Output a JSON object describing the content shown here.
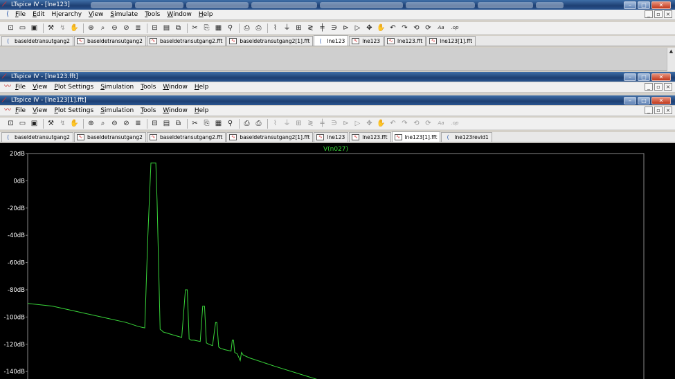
{
  "window1": {
    "title": "LTspice IV - [lne123]",
    "menu": [
      {
        "pre": "",
        "ul": "F",
        "post": "ile"
      },
      {
        "pre": "",
        "ul": "E",
        "post": "dit"
      },
      {
        "pre": "H",
        "ul": "i",
        "post": "erarchy"
      },
      {
        "pre": "",
        "ul": "V",
        "post": "iew"
      },
      {
        "pre": "",
        "ul": "S",
        "post": "imulate"
      },
      {
        "pre": "",
        "ul": "T",
        "post": "ools"
      },
      {
        "pre": "",
        "ul": "W",
        "post": "indow"
      },
      {
        "pre": "",
        "ul": "H",
        "post": "elp"
      }
    ],
    "tabs": [
      {
        "label": "baseldetransutgang2",
        "icon": "schematic-icon",
        "active": false
      },
      {
        "label": "baseldetransutgang2",
        "icon": "waveform-icon",
        "active": false
      },
      {
        "label": "baseldetransutgang2.fft",
        "icon": "waveform-icon",
        "active": false
      },
      {
        "label": "baseldetransutgang2[1].fft",
        "icon": "waveform-icon",
        "active": false
      },
      {
        "label": "lne123",
        "icon": "schematic-icon",
        "active": true
      },
      {
        "label": "lne123",
        "icon": "waveform-icon",
        "active": false
      },
      {
        "label": "lne123.fft",
        "icon": "waveform-icon",
        "active": false
      },
      {
        "label": "lne123[1].fft",
        "icon": "waveform-icon",
        "active": false
      }
    ]
  },
  "window2": {
    "title": "LTspice IV - [lne123.fft]",
    "menu": [
      {
        "pre": "",
        "ul": "F",
        "post": "ile"
      },
      {
        "pre": "",
        "ul": "V",
        "post": "iew"
      },
      {
        "pre": "",
        "ul": "P",
        "post": "lot Settings"
      },
      {
        "pre": "",
        "ul": "S",
        "post": "imulation"
      },
      {
        "pre": "",
        "ul": "T",
        "post": "ools"
      },
      {
        "pre": "",
        "ul": "W",
        "post": "indow"
      },
      {
        "pre": "",
        "ul": "H",
        "post": "elp"
      }
    ]
  },
  "window3": {
    "title": "LTspice IV - [lne123[1].fft]",
    "menu": [
      {
        "pre": "",
        "ul": "F",
        "post": "ile"
      },
      {
        "pre": "",
        "ul": "V",
        "post": "iew"
      },
      {
        "pre": "",
        "ul": "P",
        "post": "lot Settings"
      },
      {
        "pre": "",
        "ul": "S",
        "post": "imulation"
      },
      {
        "pre": "",
        "ul": "T",
        "post": "ools"
      },
      {
        "pre": "",
        "ul": "W",
        "post": "indow"
      },
      {
        "pre": "",
        "ul": "H",
        "post": "elp"
      }
    ],
    "tabs": [
      {
        "label": "baseldetransutgang2",
        "icon": "schematic-icon",
        "active": false
      },
      {
        "label": "baseldetransutgang2",
        "icon": "waveform-icon",
        "active": false
      },
      {
        "label": "baseldetransutgang2.fft",
        "icon": "waveform-icon",
        "active": false
      },
      {
        "label": "baseldetransutgang2[1].fft",
        "icon": "waveform-icon",
        "active": false
      },
      {
        "label": "lne123",
        "icon": "waveform-icon",
        "active": false
      },
      {
        "label": "lne123.fft",
        "icon": "waveform-icon",
        "active": false
      },
      {
        "label": "lne123[1].fft",
        "icon": "waveform-icon",
        "active": true
      },
      {
        "label": "lne123revid1",
        "icon": "schematic-icon",
        "active": false
      }
    ]
  },
  "toolbar_icons": [
    "new-schematic-icon",
    "open-icon",
    "save-icon",
    "control-panel-icon",
    "run-icon",
    "halt-icon",
    "zoom-in-icon",
    "pan-icon",
    "zoom-out-icon",
    "zoom-fit-icon",
    "autorange-icon",
    "tile-horizontal-icon",
    "tile-vertical-icon",
    "cascade-icon",
    "cut-icon",
    "copy-icon",
    "paste-icon",
    "find-icon",
    "print-preview-icon",
    "print-icon",
    "wire-icon",
    "ground-icon",
    "label-icon",
    "resistor-icon",
    "capacitor-icon",
    "inductor-icon",
    "diode-icon",
    "component-icon",
    "move-icon",
    "drag-icon",
    "undo-icon",
    "redo-icon",
    "rotate-icon",
    "mirror-icon",
    "text-icon",
    "spice-directive-icon"
  ],
  "colors": {
    "plot_background": "#000000",
    "trace": "#39d63a",
    "axis_text": "#ffffff",
    "grid_frame": "#888888"
  },
  "chart_data": {
    "type": "line",
    "title": "V(n027)",
    "xlabel": "",
    "ylabel": "",
    "ylim": [
      -150,
      20
    ],
    "yticks": [
      "20dB",
      "0dB",
      "-20dB",
      "-40dB",
      "-60dB",
      "-80dB",
      "-100dB",
      "-120dB",
      "-140dB"
    ],
    "ytick_values": [
      20,
      0,
      -20,
      -40,
      -60,
      -80,
      -100,
      -120,
      -140
    ],
    "x_range": [
      0,
      100
    ],
    "series": [
      {
        "color": "#39d63a",
        "x": [
          0,
          4,
          8,
          12,
          16,
          18,
          19,
          19.5,
          20,
          20.8,
          21,
          21.5,
          21.8,
          22,
          23.5,
          25,
          25.6,
          25.9,
          26.2,
          26.5,
          27,
          28,
          28.4,
          28.7,
          29,
          29.4,
          30,
          30.5,
          30.7,
          31,
          31.3,
          32,
          33,
          33.2,
          33.4,
          33.6,
          34,
          34.5,
          34.7,
          35,
          36,
          40,
          45,
          50,
          52,
          53.5
        ],
        "y": [
          -90,
          -92,
          -96,
          -100,
          -104,
          -107,
          -108,
          -40,
          13,
          13,
          -15,
          -109,
          -110,
          -111,
          -113,
          -115,
          -80,
          -80,
          -116,
          -117,
          -117,
          -118,
          -92,
          -92,
          -119,
          -120,
          -121,
          -104,
          -104,
          -122,
          -123,
          -124,
          -125,
          -117,
          -117,
          -126,
          -127,
          -132,
          -126,
          -128,
          -130,
          -136,
          -143,
          -150,
          -152,
          -154
        ]
      }
    ]
  }
}
